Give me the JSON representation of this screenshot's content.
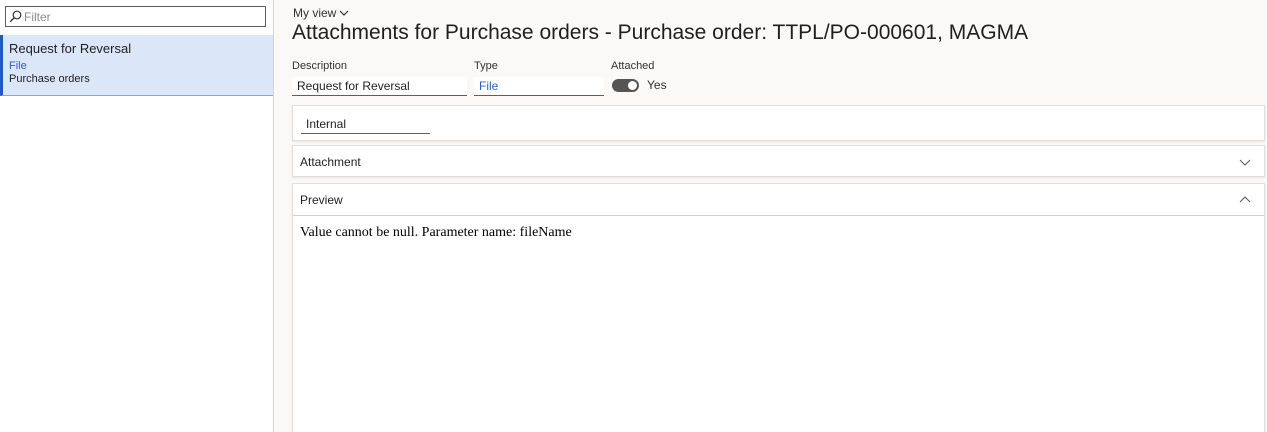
{
  "left": {
    "filter_placeholder": "Filter",
    "items": [
      {
        "title": "Request for Reversal",
        "type": "File",
        "module": "Purchase orders"
      }
    ]
  },
  "header": {
    "view_label": "My view",
    "title": "Attachments for Purchase orders - Purchase order: TTPL/PO-000601, MAGMA"
  },
  "fields": {
    "description": {
      "label": "Description",
      "value": "Request for Reversal"
    },
    "type": {
      "label": "Type",
      "value": "File"
    },
    "attached": {
      "label": "Attached",
      "value": "Yes",
      "on": true
    }
  },
  "restriction": {
    "value": "Internal"
  },
  "sections": {
    "attachment": {
      "label": "Attachment",
      "expanded": false
    },
    "preview": {
      "label": "Preview",
      "expanded": true,
      "message": "Value cannot be null. Parameter name: fileName"
    }
  },
  "colors": {
    "accent": "#1e5bbf",
    "selected_bg": "#dbe6f8",
    "link": "#2b63c2"
  }
}
